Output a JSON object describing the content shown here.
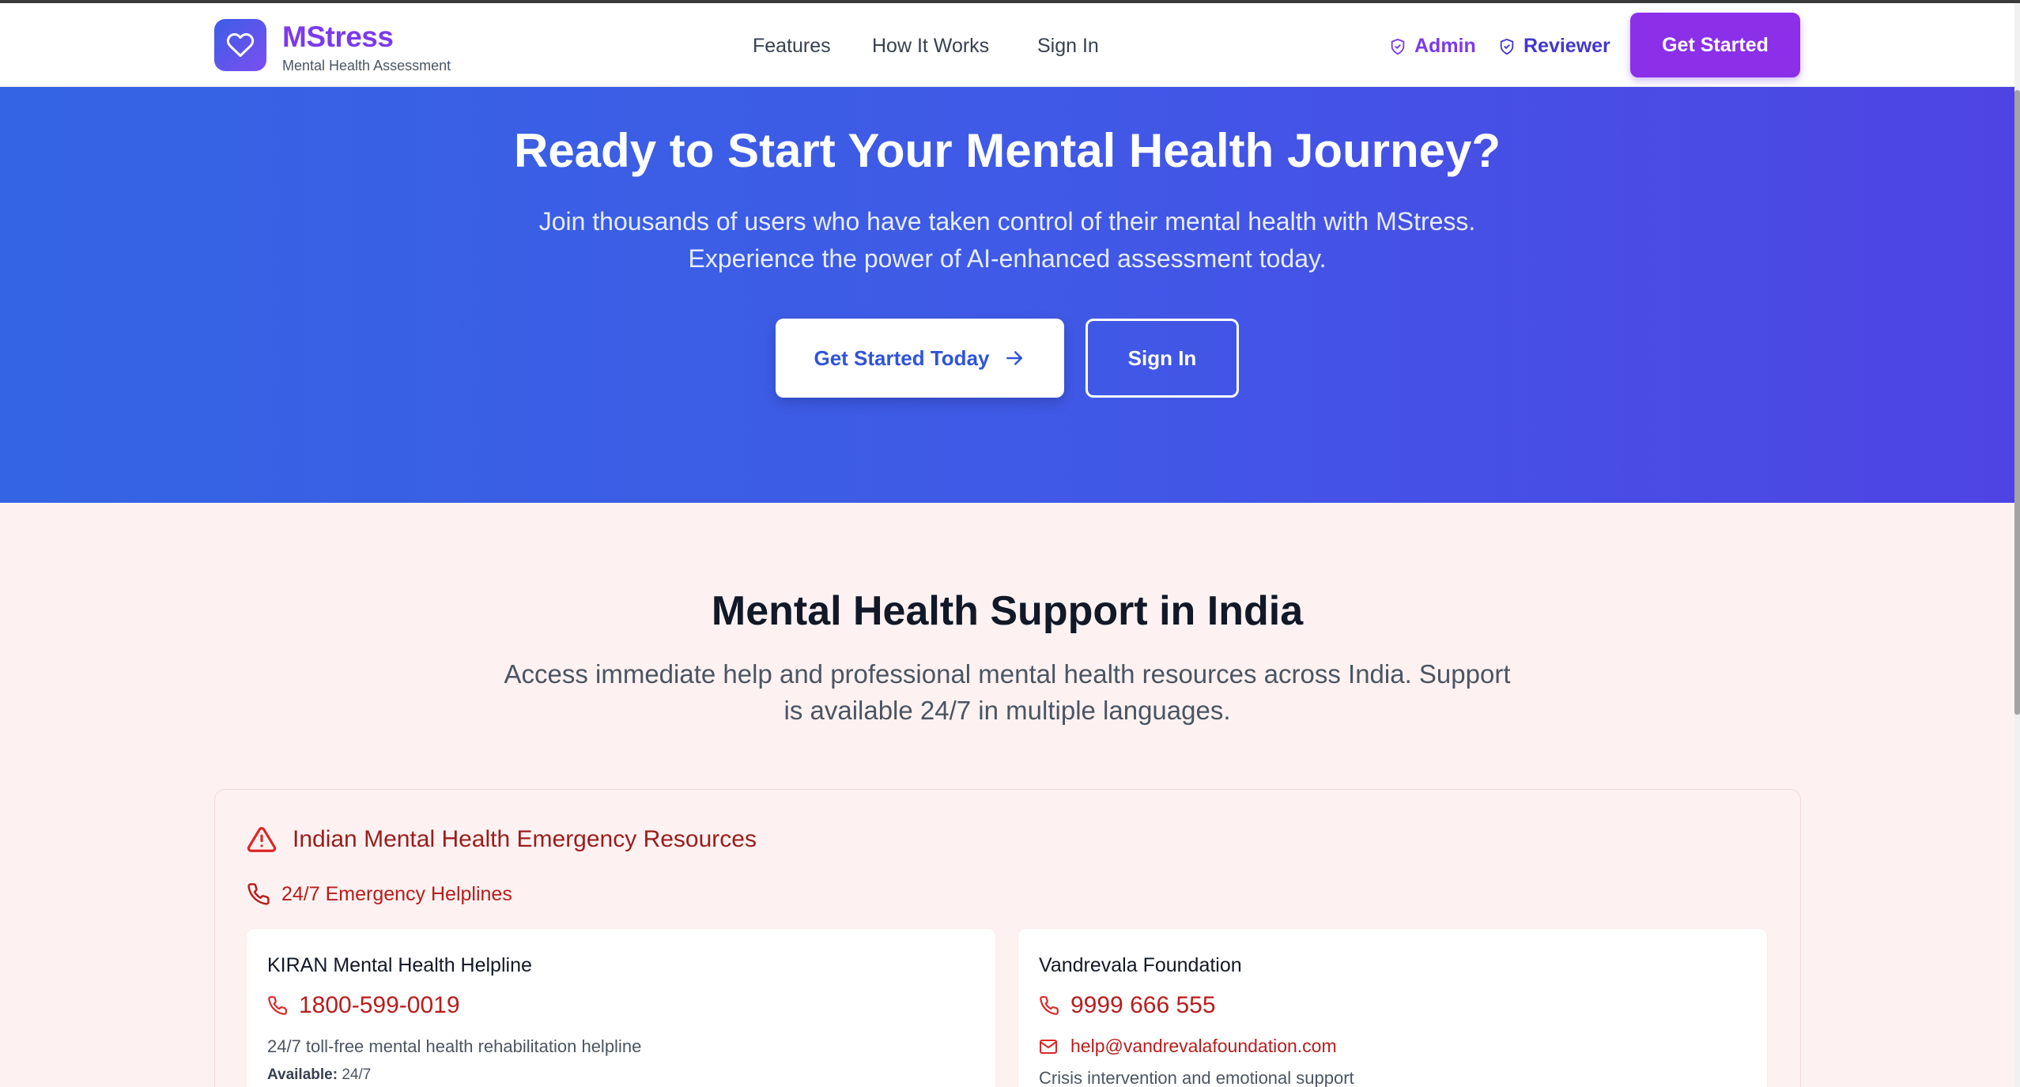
{
  "brand": {
    "name": "MStress",
    "tagline": "Mental Health Assessment"
  },
  "nav": {
    "features": "Features",
    "how_it_works": "How It Works",
    "sign_in": "Sign In",
    "admin": "Admin",
    "reviewer": "Reviewer",
    "get_started": "Get Started"
  },
  "hero": {
    "title": "Ready to Start Your Mental Health Journey?",
    "line1": "Join thousands of users who have taken control of their mental health with MStress.",
    "line2": "Experience the power of AI-enhanced assessment today.",
    "primary_button": "Get Started Today",
    "secondary_button": "Sign In"
  },
  "support": {
    "title": "Mental Health Support in India",
    "line1": "Access immediate help and professional mental health resources across India. Support",
    "line2": "is available 24/7 in multiple languages.",
    "emergency_title": "Indian Mental Health Emergency Resources",
    "helplines_heading": "24/7 Emergency Helplines",
    "helplines": [
      {
        "name": "KIRAN Mental Health Helpline",
        "phone": "1800-599-0019",
        "description": "24/7 toll-free mental health rehabilitation helpline",
        "available_label": "Available:",
        "available_value": "24/7"
      },
      {
        "name": "Vandrevala Foundation",
        "phone": "9999 666 555",
        "email": "help@vandrevalafoundation.com",
        "description": "Crisis intervention and emotional support"
      }
    ]
  },
  "colors": {
    "brand_purple": "#7c3aed",
    "button_purple": "#8b2fe8",
    "hero_blue": "#3f5ae6",
    "emergency_red": "#b91c1c",
    "section_bg": "#fdf2f1"
  },
  "icons": {
    "logo": "heart-icon",
    "role": "shield-icon",
    "arrow": "arrow-right-icon",
    "alert": "alert-triangle-icon",
    "phone": "phone-icon",
    "mail": "mail-icon"
  }
}
